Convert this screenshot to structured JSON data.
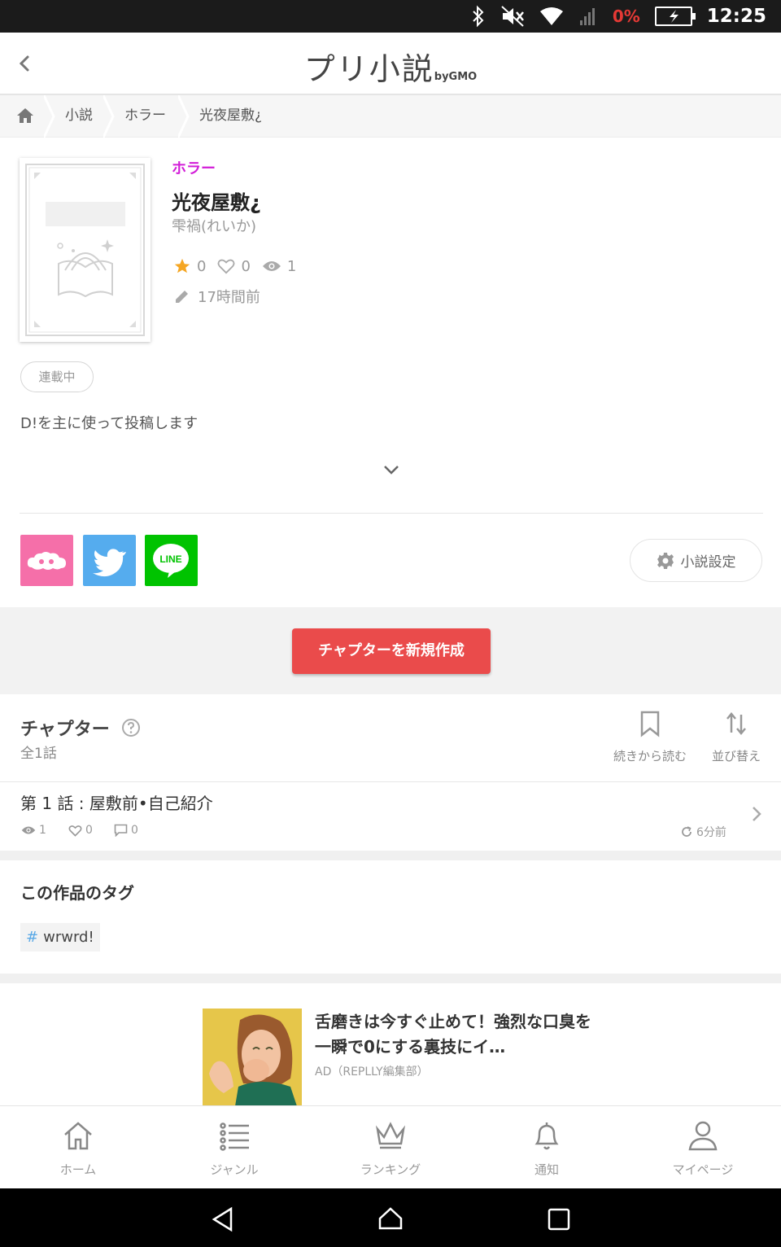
{
  "status_bar": {
    "battery": "0%",
    "time": "12:25"
  },
  "header": {
    "logo": "プリ小説",
    "logo_by": "byGMO"
  },
  "breadcrumb": {
    "items": [
      "小説",
      "ホラー",
      "光夜屋敷¿"
    ]
  },
  "novel": {
    "genre": "ホラー",
    "title": "光夜屋敷¿",
    "author": "雫禍(れいか)",
    "stars": "0",
    "likes": "0",
    "views": "1",
    "updated": "17時間前",
    "status": "連載中",
    "description": "D!を主に使って投稿します"
  },
  "settings_label": "小説設定",
  "create_chapter_label": "チャプターを新規作成",
  "chapters": {
    "heading": "チャプター",
    "count": "全1話",
    "continue_label": "続きから読む",
    "sort_label": "並び替え",
    "items": [
      {
        "title": "第 1 話 : 屋敷前•自己紹介",
        "views": "1",
        "likes": "0",
        "comments": "0",
        "time": "6分前"
      }
    ]
  },
  "tags": {
    "heading": "この作品のタグ",
    "items": [
      {
        "hash": "#",
        "label": "wrwrd!"
      }
    ]
  },
  "ad": {
    "title": "舌磨きは今すぐ止めて！強烈な口臭を一瞬で0にする裏技にイ…",
    "source": "AD（REPLLY編集部）"
  },
  "bottom_nav": [
    {
      "label": "ホーム",
      "icon": "home-icon"
    },
    {
      "label": "ジャンル",
      "icon": "list-icon"
    },
    {
      "label": "ランキング",
      "icon": "crown-icon"
    },
    {
      "label": "通知",
      "icon": "bell-icon"
    },
    {
      "label": "マイページ",
      "icon": "person-icon"
    }
  ],
  "colors": {
    "genre": "#d21dd8",
    "create_button": "#ea4b4b",
    "twitter": "#55acee",
    "line": "#00c300",
    "pink_share": "#f56fa9"
  }
}
